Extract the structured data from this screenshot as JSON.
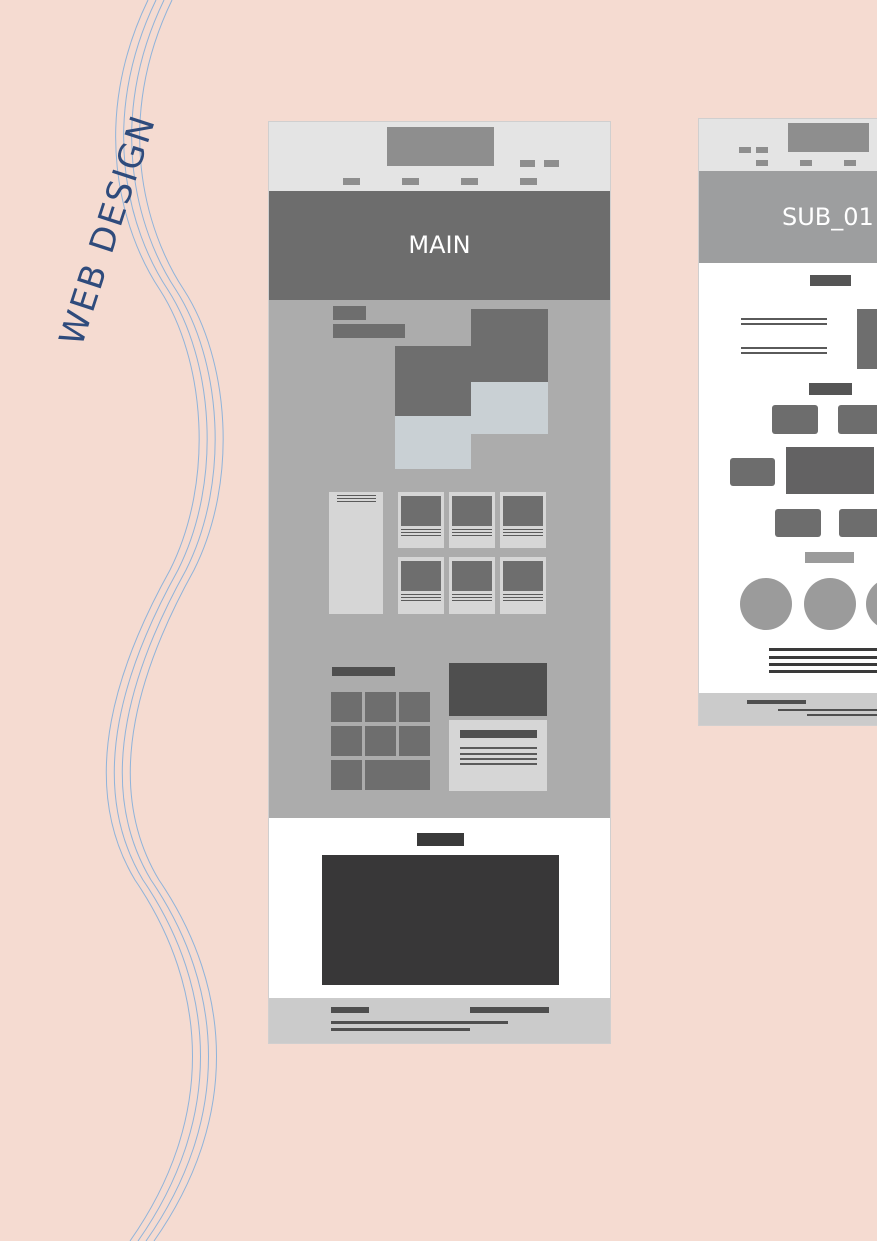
{
  "decoration": {
    "title": "WEB DESIGN",
    "title_color": "#2f4b7c",
    "wave_color": "#8fb3da",
    "background": "#f5dbd1"
  },
  "main_mockup": {
    "label": "MAIN"
  },
  "sub_mockup": {
    "label": "SUB_01"
  }
}
